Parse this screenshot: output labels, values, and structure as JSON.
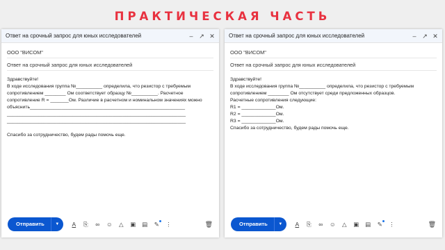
{
  "slide_title": "ПРАКТИЧЕСКАЯ ЧАСТЬ",
  "left": {
    "window_title": "Ответ на срочный запрос для юных исследователей",
    "to": "ООО \"ВИСОМ\"",
    "subject": "Ответ на срочный запрос для юных исследователей",
    "body": "Здравствуйте!\nВ ходе исследования группа №__________ определила, что резистор с требуемым\nсопротивлением ________ Ом соответствует образцу №__________. Расчетное\nсопротивление R = _______Ом. Различие в расчетном и номинальном значениях можно\nобъяснить___________________________________________________________\n____________________________________________________________________\n____________________________________________________________________\n\nСпасибо за сотрудничество, будем рады помочь еще.",
    "send_label": "Отправить"
  },
  "right": {
    "window_title": "Ответ на срочный запрос для юных исследователей",
    "to": "ООО \"ВИСОМ\"",
    "subject": "Ответ на срочный запрос для юных исследователей",
    "body": "Здравствуйте!\nВ ходе исследования группа №__________ определила, что резистор с требуемым\nсопротивлением ________ Ом отсутствует среди предложенных образцов.\nРасчетные сопротивления следующие:\nR1 = _____________Ом.\nR2 = _____________Ом.\nR3 = _____________Ом.\nСпасибо за сотрудничество, будем рады помочь еще.",
    "send_label": "Отправить"
  },
  "icons": {
    "titlebar": [
      "minimize-icon",
      "expand-icon",
      "close-icon"
    ],
    "toolbar": [
      "text-format-icon",
      "attach-icon",
      "link-icon",
      "emoji-icon",
      "drive-icon",
      "photo-icon",
      "lock-icon",
      "signature-icon",
      "more-options-icon",
      "trash-icon"
    ],
    "accent": "#0b57d0",
    "title_color": "#e8313f"
  }
}
